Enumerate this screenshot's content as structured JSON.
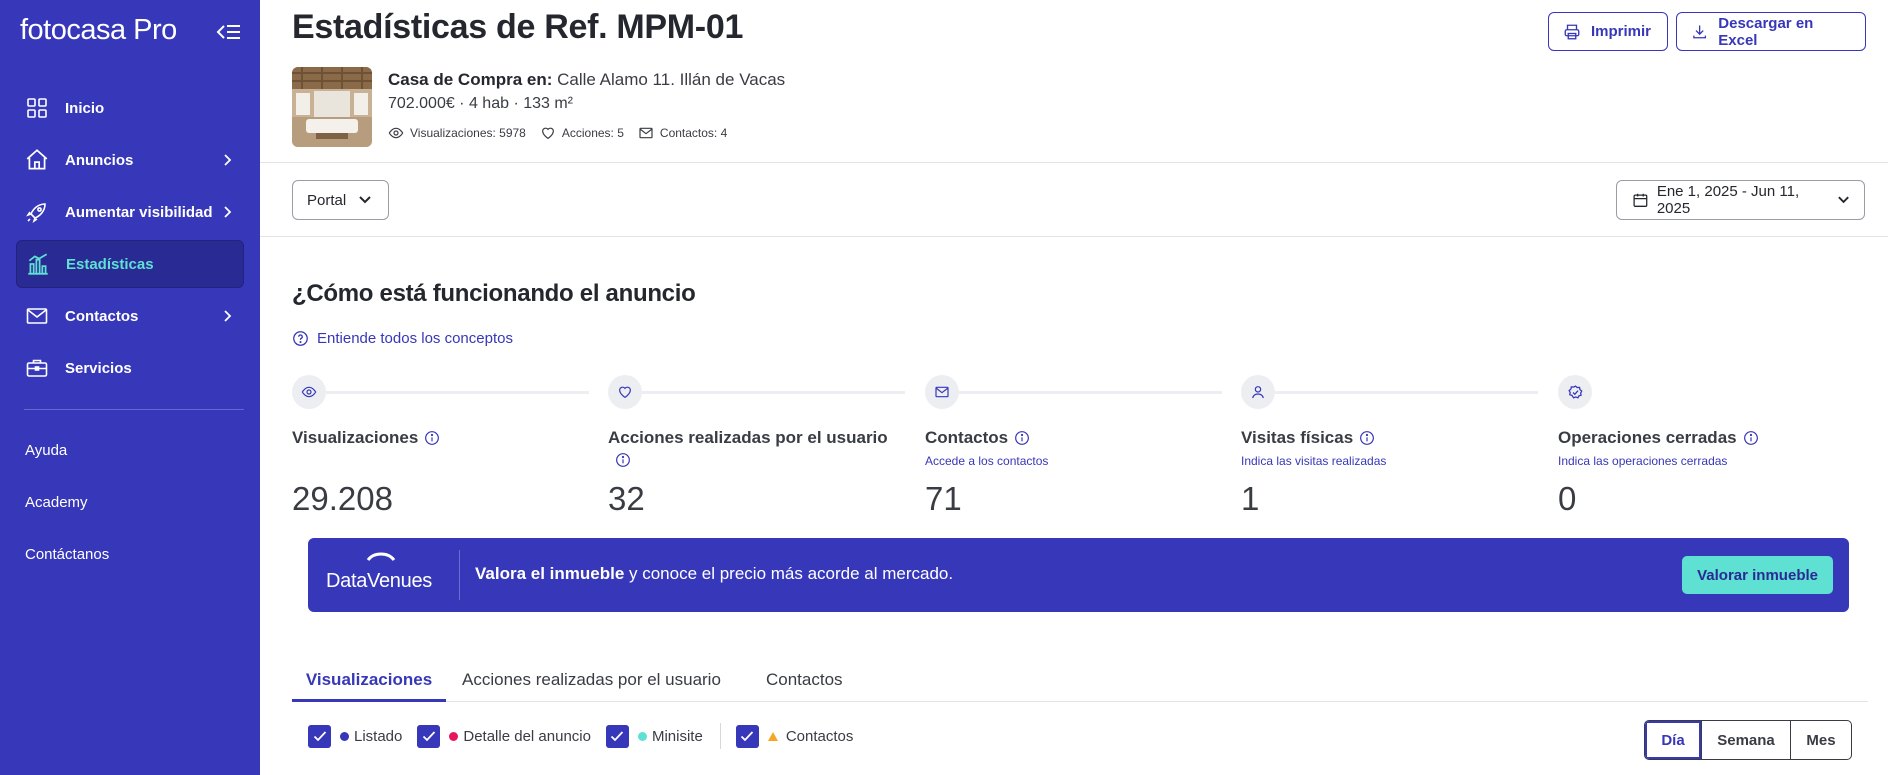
{
  "sidebar": {
    "logo": "fotocasa Pro",
    "items": [
      {
        "label": "Inicio",
        "icon": "grid-icon"
      },
      {
        "label": "Anuncios",
        "icon": "home-icon"
      },
      {
        "label": "Aumentar visibilidad",
        "icon": "rocket-icon"
      },
      {
        "label": "Estadísticas",
        "icon": "chart-icon"
      },
      {
        "label": "Contactos",
        "icon": "mail-icon"
      },
      {
        "label": "Servicios",
        "icon": "briefcase-icon"
      }
    ],
    "links": [
      "Ayuda",
      "Academy",
      "Contáctanos"
    ],
    "active_color": "#5ee0d2",
    "background": "#3737b9"
  },
  "header": {
    "title": "Estadísticas de Ref. MPM-01",
    "print_label": "Imprimir",
    "excel_label": "Descargar en Excel"
  },
  "property": {
    "title_prefix": "Casa de Compra en:",
    "address": "Calle Alamo 11. Illán de Vacas",
    "details": "702.000€ · 4 hab · 133 m²",
    "views": "Visualizaciones: 5978",
    "actions": "Acciones: 5",
    "contacts": "Contactos: 4"
  },
  "filters": {
    "portal": "Portal",
    "date_range": "Ene 1, 2025 - Jun 11, 2025"
  },
  "performance": {
    "title": "¿Cómo está funcionando el anuncio",
    "concepts_link": "Entiende todos los conceptos",
    "metrics": [
      {
        "label": "Visualizaciones",
        "link": "",
        "value": "29.208",
        "icon": "eye-icon"
      },
      {
        "label": "Acciones realizadas por el usuario",
        "link": "",
        "value": "32",
        "icon": "heart-icon"
      },
      {
        "label": "Contactos",
        "link": "Accede a los contactos",
        "value": "71",
        "icon": "mail-icon"
      },
      {
        "label": "Visitas físicas",
        "link": "Indica las visitas realizadas",
        "value": "1",
        "icon": "user-icon"
      },
      {
        "label": "Operaciones cerradas",
        "link": "Indica las operaciones cerradas",
        "value": "0",
        "icon": "badge-check-icon"
      }
    ]
  },
  "banner": {
    "brand": "DataVenues",
    "bold": "Valora el inmueble",
    "rest": " y conoce el precio más acorde al mercado.",
    "cta": "Valorar inmueble"
  },
  "tabs": [
    "Visualizaciones",
    "Acciones realizadas por el usuario",
    "Contactos"
  ],
  "legend": [
    {
      "label": "Listado",
      "color": "#3737b9"
    },
    {
      "label": "Detalle del anuncio",
      "color": "#e5175a"
    },
    {
      "label": "Minisite",
      "color": "#5ee0d2"
    },
    {
      "label": "Contactos",
      "color": "#f5a623"
    }
  ],
  "granularity": [
    "Día",
    "Semana",
    "Mes"
  ]
}
